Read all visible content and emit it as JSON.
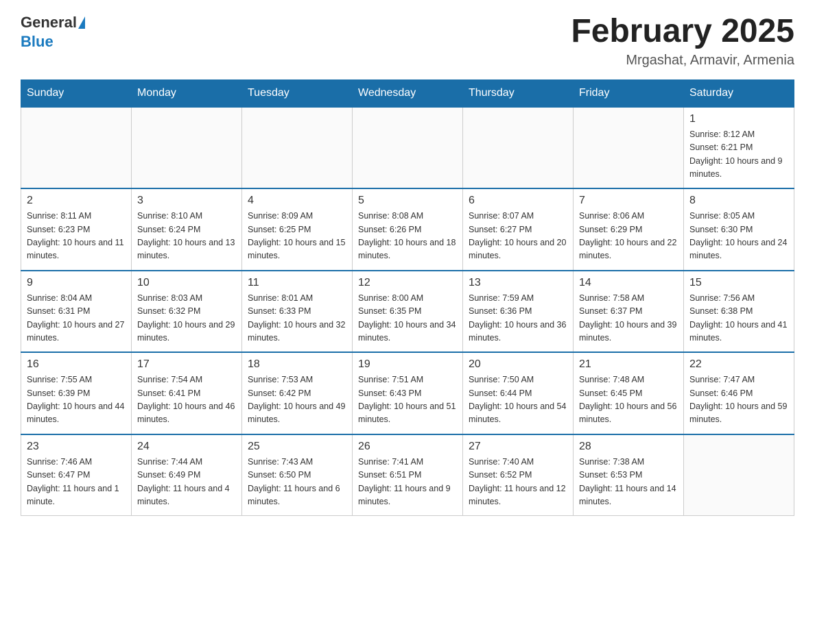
{
  "header": {
    "logo_general": "General",
    "logo_blue": "Blue",
    "title": "February 2025",
    "subtitle": "Mrgashat, Armavir, Armenia"
  },
  "weekdays": [
    "Sunday",
    "Monday",
    "Tuesday",
    "Wednesday",
    "Thursday",
    "Friday",
    "Saturday"
  ],
  "weeks": [
    [
      {
        "day": "",
        "info": ""
      },
      {
        "day": "",
        "info": ""
      },
      {
        "day": "",
        "info": ""
      },
      {
        "day": "",
        "info": ""
      },
      {
        "day": "",
        "info": ""
      },
      {
        "day": "",
        "info": ""
      },
      {
        "day": "1",
        "info": "Sunrise: 8:12 AM\nSunset: 6:21 PM\nDaylight: 10 hours and 9 minutes."
      }
    ],
    [
      {
        "day": "2",
        "info": "Sunrise: 8:11 AM\nSunset: 6:23 PM\nDaylight: 10 hours and 11 minutes."
      },
      {
        "day": "3",
        "info": "Sunrise: 8:10 AM\nSunset: 6:24 PM\nDaylight: 10 hours and 13 minutes."
      },
      {
        "day": "4",
        "info": "Sunrise: 8:09 AM\nSunset: 6:25 PM\nDaylight: 10 hours and 15 minutes."
      },
      {
        "day": "5",
        "info": "Sunrise: 8:08 AM\nSunset: 6:26 PM\nDaylight: 10 hours and 18 minutes."
      },
      {
        "day": "6",
        "info": "Sunrise: 8:07 AM\nSunset: 6:27 PM\nDaylight: 10 hours and 20 minutes."
      },
      {
        "day": "7",
        "info": "Sunrise: 8:06 AM\nSunset: 6:29 PM\nDaylight: 10 hours and 22 minutes."
      },
      {
        "day": "8",
        "info": "Sunrise: 8:05 AM\nSunset: 6:30 PM\nDaylight: 10 hours and 24 minutes."
      }
    ],
    [
      {
        "day": "9",
        "info": "Sunrise: 8:04 AM\nSunset: 6:31 PM\nDaylight: 10 hours and 27 minutes."
      },
      {
        "day": "10",
        "info": "Sunrise: 8:03 AM\nSunset: 6:32 PM\nDaylight: 10 hours and 29 minutes."
      },
      {
        "day": "11",
        "info": "Sunrise: 8:01 AM\nSunset: 6:33 PM\nDaylight: 10 hours and 32 minutes."
      },
      {
        "day": "12",
        "info": "Sunrise: 8:00 AM\nSunset: 6:35 PM\nDaylight: 10 hours and 34 minutes."
      },
      {
        "day": "13",
        "info": "Sunrise: 7:59 AM\nSunset: 6:36 PM\nDaylight: 10 hours and 36 minutes."
      },
      {
        "day": "14",
        "info": "Sunrise: 7:58 AM\nSunset: 6:37 PM\nDaylight: 10 hours and 39 minutes."
      },
      {
        "day": "15",
        "info": "Sunrise: 7:56 AM\nSunset: 6:38 PM\nDaylight: 10 hours and 41 minutes."
      }
    ],
    [
      {
        "day": "16",
        "info": "Sunrise: 7:55 AM\nSunset: 6:39 PM\nDaylight: 10 hours and 44 minutes."
      },
      {
        "day": "17",
        "info": "Sunrise: 7:54 AM\nSunset: 6:41 PM\nDaylight: 10 hours and 46 minutes."
      },
      {
        "day": "18",
        "info": "Sunrise: 7:53 AM\nSunset: 6:42 PM\nDaylight: 10 hours and 49 minutes."
      },
      {
        "day": "19",
        "info": "Sunrise: 7:51 AM\nSunset: 6:43 PM\nDaylight: 10 hours and 51 minutes."
      },
      {
        "day": "20",
        "info": "Sunrise: 7:50 AM\nSunset: 6:44 PM\nDaylight: 10 hours and 54 minutes."
      },
      {
        "day": "21",
        "info": "Sunrise: 7:48 AM\nSunset: 6:45 PM\nDaylight: 10 hours and 56 minutes."
      },
      {
        "day": "22",
        "info": "Sunrise: 7:47 AM\nSunset: 6:46 PM\nDaylight: 10 hours and 59 minutes."
      }
    ],
    [
      {
        "day": "23",
        "info": "Sunrise: 7:46 AM\nSunset: 6:47 PM\nDaylight: 11 hours and 1 minute."
      },
      {
        "day": "24",
        "info": "Sunrise: 7:44 AM\nSunset: 6:49 PM\nDaylight: 11 hours and 4 minutes."
      },
      {
        "day": "25",
        "info": "Sunrise: 7:43 AM\nSunset: 6:50 PM\nDaylight: 11 hours and 6 minutes."
      },
      {
        "day": "26",
        "info": "Sunrise: 7:41 AM\nSunset: 6:51 PM\nDaylight: 11 hours and 9 minutes."
      },
      {
        "day": "27",
        "info": "Sunrise: 7:40 AM\nSunset: 6:52 PM\nDaylight: 11 hours and 12 minutes."
      },
      {
        "day": "28",
        "info": "Sunrise: 7:38 AM\nSunset: 6:53 PM\nDaylight: 11 hours and 14 minutes."
      },
      {
        "day": "",
        "info": ""
      }
    ]
  ]
}
